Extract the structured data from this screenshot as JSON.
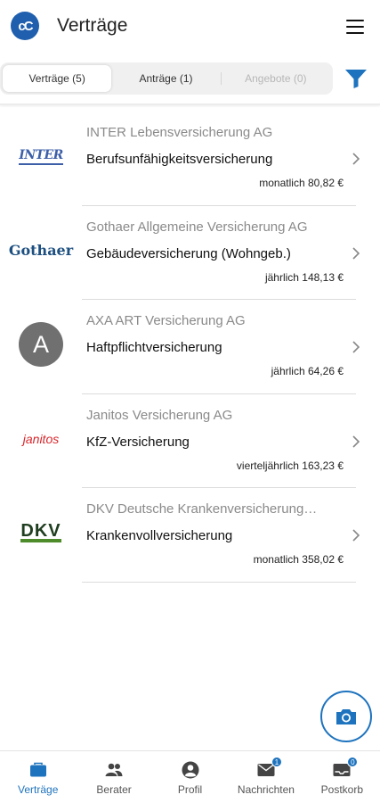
{
  "header": {
    "logo_text": "cC",
    "title": "Verträge"
  },
  "tabs": [
    {
      "label": "Verträge (5)",
      "active": true
    },
    {
      "label": "Anträge (1)",
      "active": false
    },
    {
      "label": "Angebote (0)",
      "active": false,
      "disabled": true
    }
  ],
  "contracts": [
    {
      "company": "INTER Lebensversicherung AG",
      "product": "Berufsunfähigkeitsversicherung",
      "price": "monatlich 80,82 €",
      "logo": "inter-logo",
      "logo_text": "INTER"
    },
    {
      "company": "Gothaer Allgemeine Versicherung AG",
      "product": "Gebäudeversicherung (Wohngeb.)",
      "price": "jährlich 148,13 €",
      "logo": "gothaer-logo",
      "logo_text": "Gothaer"
    },
    {
      "company": "AXA ART Versicherung AG",
      "product": "Haftpflichtversicherung",
      "price": "jährlich 64,26 €",
      "logo": "letter-avatar",
      "logo_text": "A"
    },
    {
      "company": "Janitos Versicherung AG",
      "product": "KfZ-Versicherung",
      "price": "vierteljährlich 163,23 €",
      "logo": "janitos-logo",
      "logo_text": "janitos"
    },
    {
      "company": "DKV Deutsche Krankenversicherung…",
      "product": "Krankenvollversicherung",
      "price": "monatlich 358,02 €",
      "logo": "dkv-logo",
      "logo_text": "DKV"
    }
  ],
  "bottom_nav": [
    {
      "label": "Verträge",
      "icon": "briefcase-icon",
      "active": true
    },
    {
      "label": "Berater",
      "icon": "people-icon"
    },
    {
      "label": "Profil",
      "icon": "profile-icon"
    },
    {
      "label": "Nachrichten",
      "icon": "mail-icon",
      "badge": "1"
    },
    {
      "label": "Postkorb",
      "icon": "inbox-icon",
      "badge": "0"
    }
  ],
  "colors": {
    "accent": "#1e73be",
    "muted": "#8a8a8a"
  }
}
